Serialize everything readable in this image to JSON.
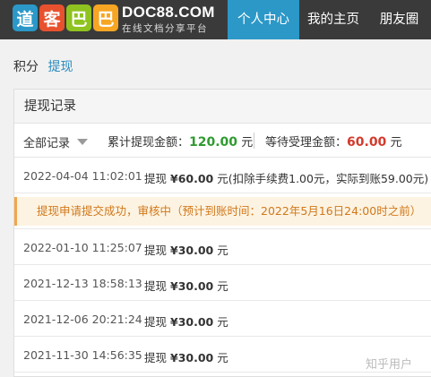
{
  "header": {
    "logo_chars": [
      "道",
      "客",
      "巴",
      "巴"
    ],
    "logo_colors": [
      "#2b98c8",
      "#e8512e",
      "#8fc320",
      "#f6a623"
    ],
    "site_name": "DOC88.COM",
    "tagline": "在线文档分享平台",
    "tabs": [
      {
        "label": "个人中心",
        "active": true
      },
      {
        "label": "我的主页",
        "active": false
      },
      {
        "label": "朋友圈",
        "active": false
      }
    ]
  },
  "breadcrumb": {
    "parent": "积分",
    "current": "提现"
  },
  "panel": {
    "title": "提现记录",
    "filter_label": "全部记录",
    "total_label": "累计提现金额：",
    "total_amount": "120.00",
    "total_unit": "元",
    "pending_label": "等待受理金额：",
    "pending_amount": "60.00",
    "pending_unit": "元"
  },
  "records": [
    {
      "date": "2022-04-04 11:02:01",
      "action": "提现",
      "amount": "¥60.00",
      "unit": "元",
      "note": "(扣除手续费1.00元，实际到账59.00元)"
    },
    {
      "date": "2022-01-10 11:25:07",
      "action": "提现",
      "amount": "¥30.00",
      "unit": "元",
      "note": ""
    },
    {
      "date": "2021-12-13 18:58:13",
      "action": "提现",
      "amount": "¥30.00",
      "unit": "元",
      "note": ""
    },
    {
      "date": "2021-12-06 20:21:24",
      "action": "提现",
      "amount": "¥30.00",
      "unit": "元",
      "note": ""
    },
    {
      "date": "2021-11-30 14:56:35",
      "action": "提现",
      "amount": "¥30.00",
      "unit": "元",
      "note": ""
    }
  ],
  "notice": "提现申请提交成功，审核中（预计到账时间：2022年5月16日24:00时之前）",
  "watermark": "知乎用户",
  "colors": {
    "topbar": "#3a3a3a",
    "active_tab": "#2b98c8",
    "link": "#2a8abf",
    "green": "#2f9b2f",
    "red": "#d33a2c",
    "notice_text": "#d0781a"
  }
}
